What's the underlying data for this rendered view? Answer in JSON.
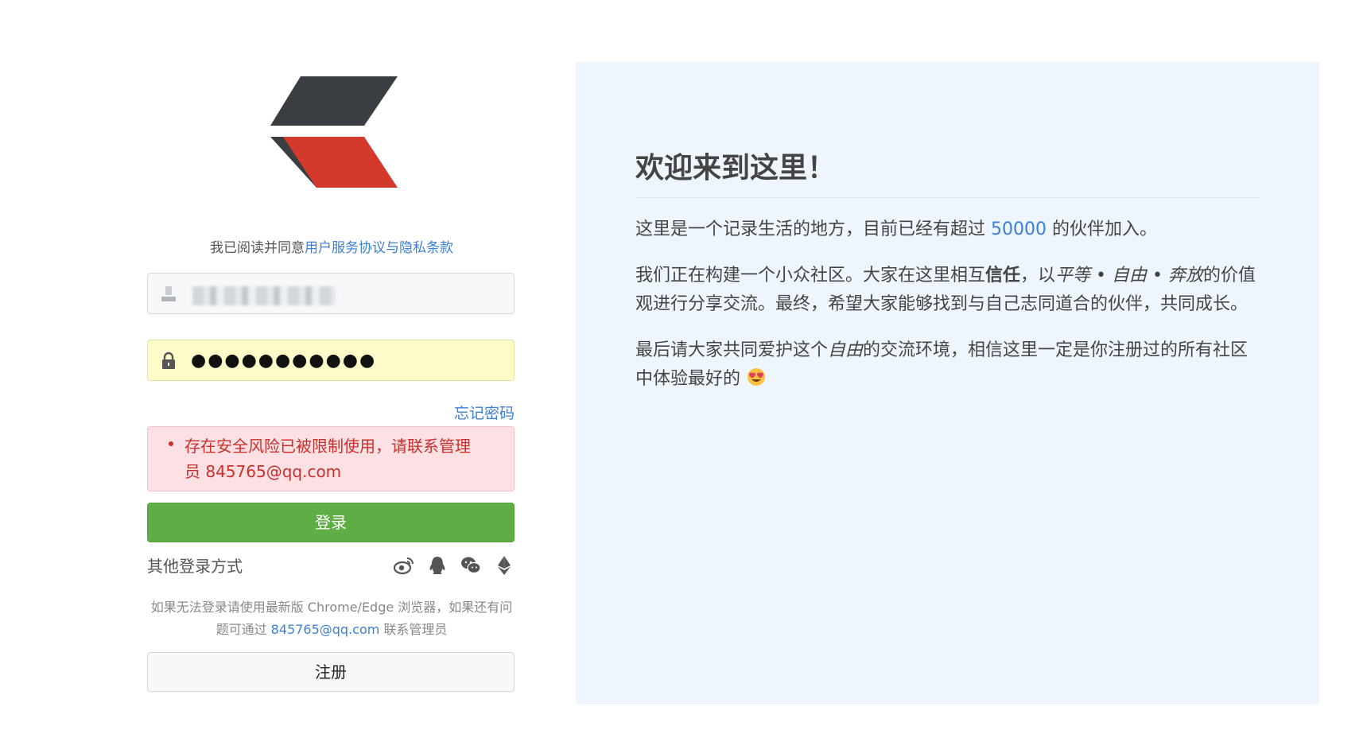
{
  "login": {
    "agree_prefix": "我已阅读并同意",
    "agree_link": "用户服务协议与隐私条款",
    "username_value": "",
    "password_dots": "●●●●●●●●●●●",
    "forgot_label": "忘记密码",
    "error_message": "存在安全风险已被限制使用，请联系管理员 845765@qq.com",
    "login_label": "登录",
    "other_login_label": "其他登录方式",
    "help_prefix": "如果无法登录请使用最新版 Chrome/Edge 浏览器，如果还有问题可通过 ",
    "help_email": "845765@qq.com",
    "help_suffix": " 联系管理员",
    "register_label": "注册",
    "social_icons": [
      "weibo-icon",
      "qq-icon",
      "wechat-icon",
      "ethereum-icon"
    ]
  },
  "welcome": {
    "title": "欢迎来到这里！",
    "p1_prefix": "这里是一个记录生活的地方，目前已经有超过 ",
    "p1_number": "50000",
    "p1_suffix": " 的伙伴加入。",
    "p2_a": "我们正在构建一个小众社区。大家在这里相互",
    "p2_bold": "信任",
    "p2_b": "，以",
    "p2_italic": "平等 • 自由 • 奔放",
    "p2_c": "的价值观进行分享交流。最终，希望大家能够找到与自己志同道合的伙伴，共同成长。",
    "p3_a": "最后请大家共同爱护这个",
    "p3_italic": "自由",
    "p3_b": "的交流环境，相信这里一定是你注册过的所有社区中体验最好的",
    "emoji": "heart-eyes-emoji"
  },
  "colors": {
    "accent": "#3b7fd6",
    "login_green": "#5fad45",
    "error_red": "#c9302c",
    "panel_bg": "#eef5fd",
    "logo_dark": "#3a3d42",
    "logo_red": "#d33a2c"
  }
}
